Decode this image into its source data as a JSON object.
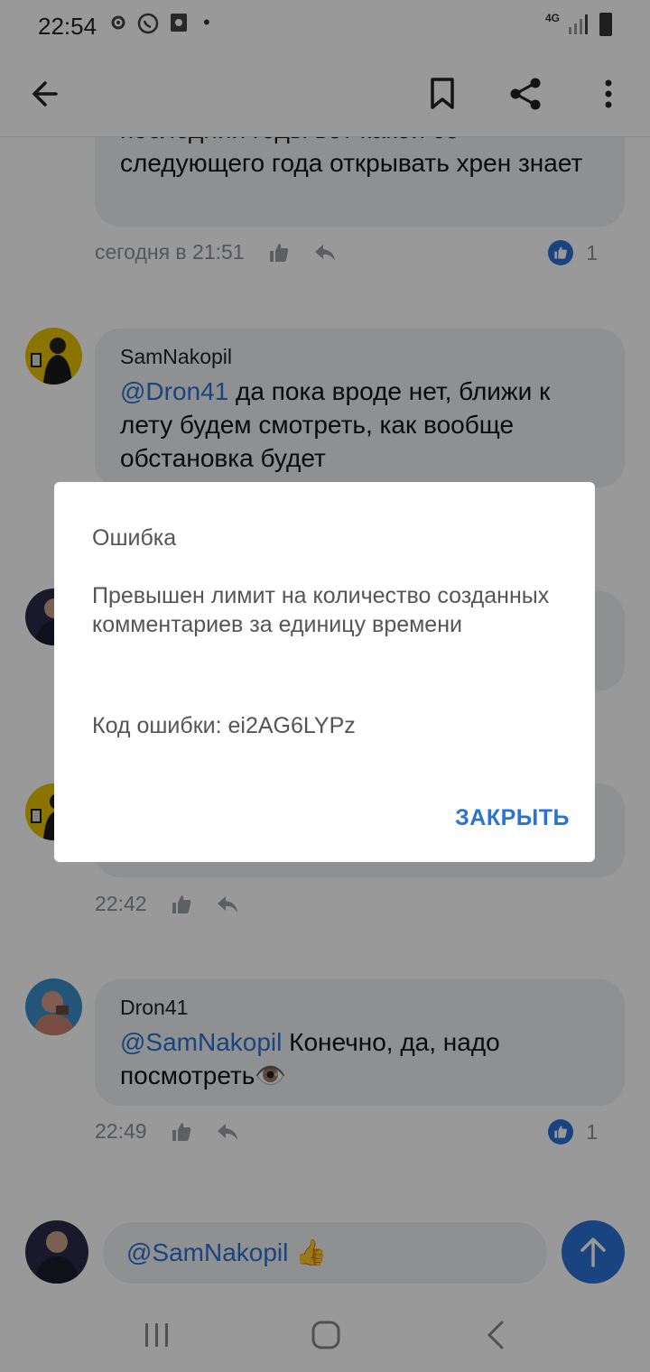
{
  "status_bar": {
    "time": "22:54",
    "network": "4G"
  },
  "header": {
    "back_icon": "arrow-left-icon",
    "bookmark_icon": "bookmark-icon",
    "share_icon": "share-icon",
    "more_icon": "more-vertical-icon"
  },
  "comments": [
    {
      "text": "последний годы вот какой со следующего года открывать хрен знает",
      "time": "сегодня в 21:51",
      "likes": "1"
    },
    {
      "author": "SamNakopil",
      "mention": "@Dron41",
      "text": " да пока вроде нет, ближи к лету будем смотреть, как вообще обстановка будет"
    },
    {
      "time": "22:42"
    },
    {
      "author": "Dron41",
      "mention": "@SamNakopil",
      "text": " Конечно, да, надо посмотреть👁️",
      "time": "22:49",
      "likes": "1"
    }
  ],
  "composer": {
    "value": "@SamNakopil 👍"
  },
  "dialog": {
    "title": "Ошибка",
    "message": "Превышен лимит на количество созданных комментариев за единицу времени",
    "code": "Код ошибки: ei2AG6LYPz",
    "close_label": "ЗАКРЫТЬ"
  },
  "colors": {
    "accent": "#2a72d4",
    "bubble": "#eef0f3",
    "meta": "#8a8f96"
  }
}
